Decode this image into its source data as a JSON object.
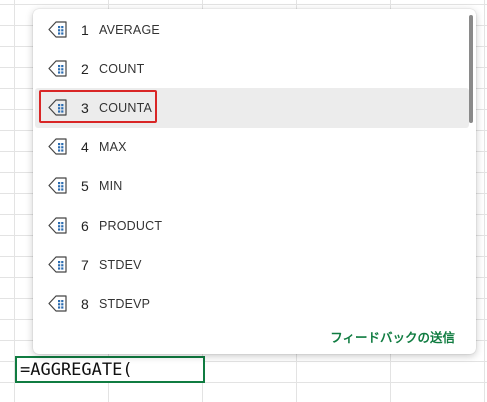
{
  "autocomplete": {
    "items": [
      {
        "number": "1",
        "name": "AVERAGE",
        "icon": "function-list-icon"
      },
      {
        "number": "2",
        "name": "COUNT",
        "icon": "function-list-icon"
      },
      {
        "number": "3",
        "name": "COUNTA",
        "icon": "function-list-icon"
      },
      {
        "number": "4",
        "name": "MAX",
        "icon": "function-list-icon"
      },
      {
        "number": "5",
        "name": "MIN",
        "icon": "function-list-icon"
      },
      {
        "number": "6",
        "name": "PRODUCT",
        "icon": "function-list-icon"
      },
      {
        "number": "7",
        "name": "STDEV",
        "icon": "function-list-icon"
      },
      {
        "number": "8",
        "name": "STDEVP",
        "icon": "function-list-icon"
      }
    ],
    "highlighted_index": 2,
    "feedback_label": "フィードバックの送信"
  },
  "cell": {
    "formula": "=AGGREGATE("
  },
  "colors": {
    "accent": "#107c41",
    "selection_outline": "#d92626",
    "highlight_bg": "#ececec"
  }
}
